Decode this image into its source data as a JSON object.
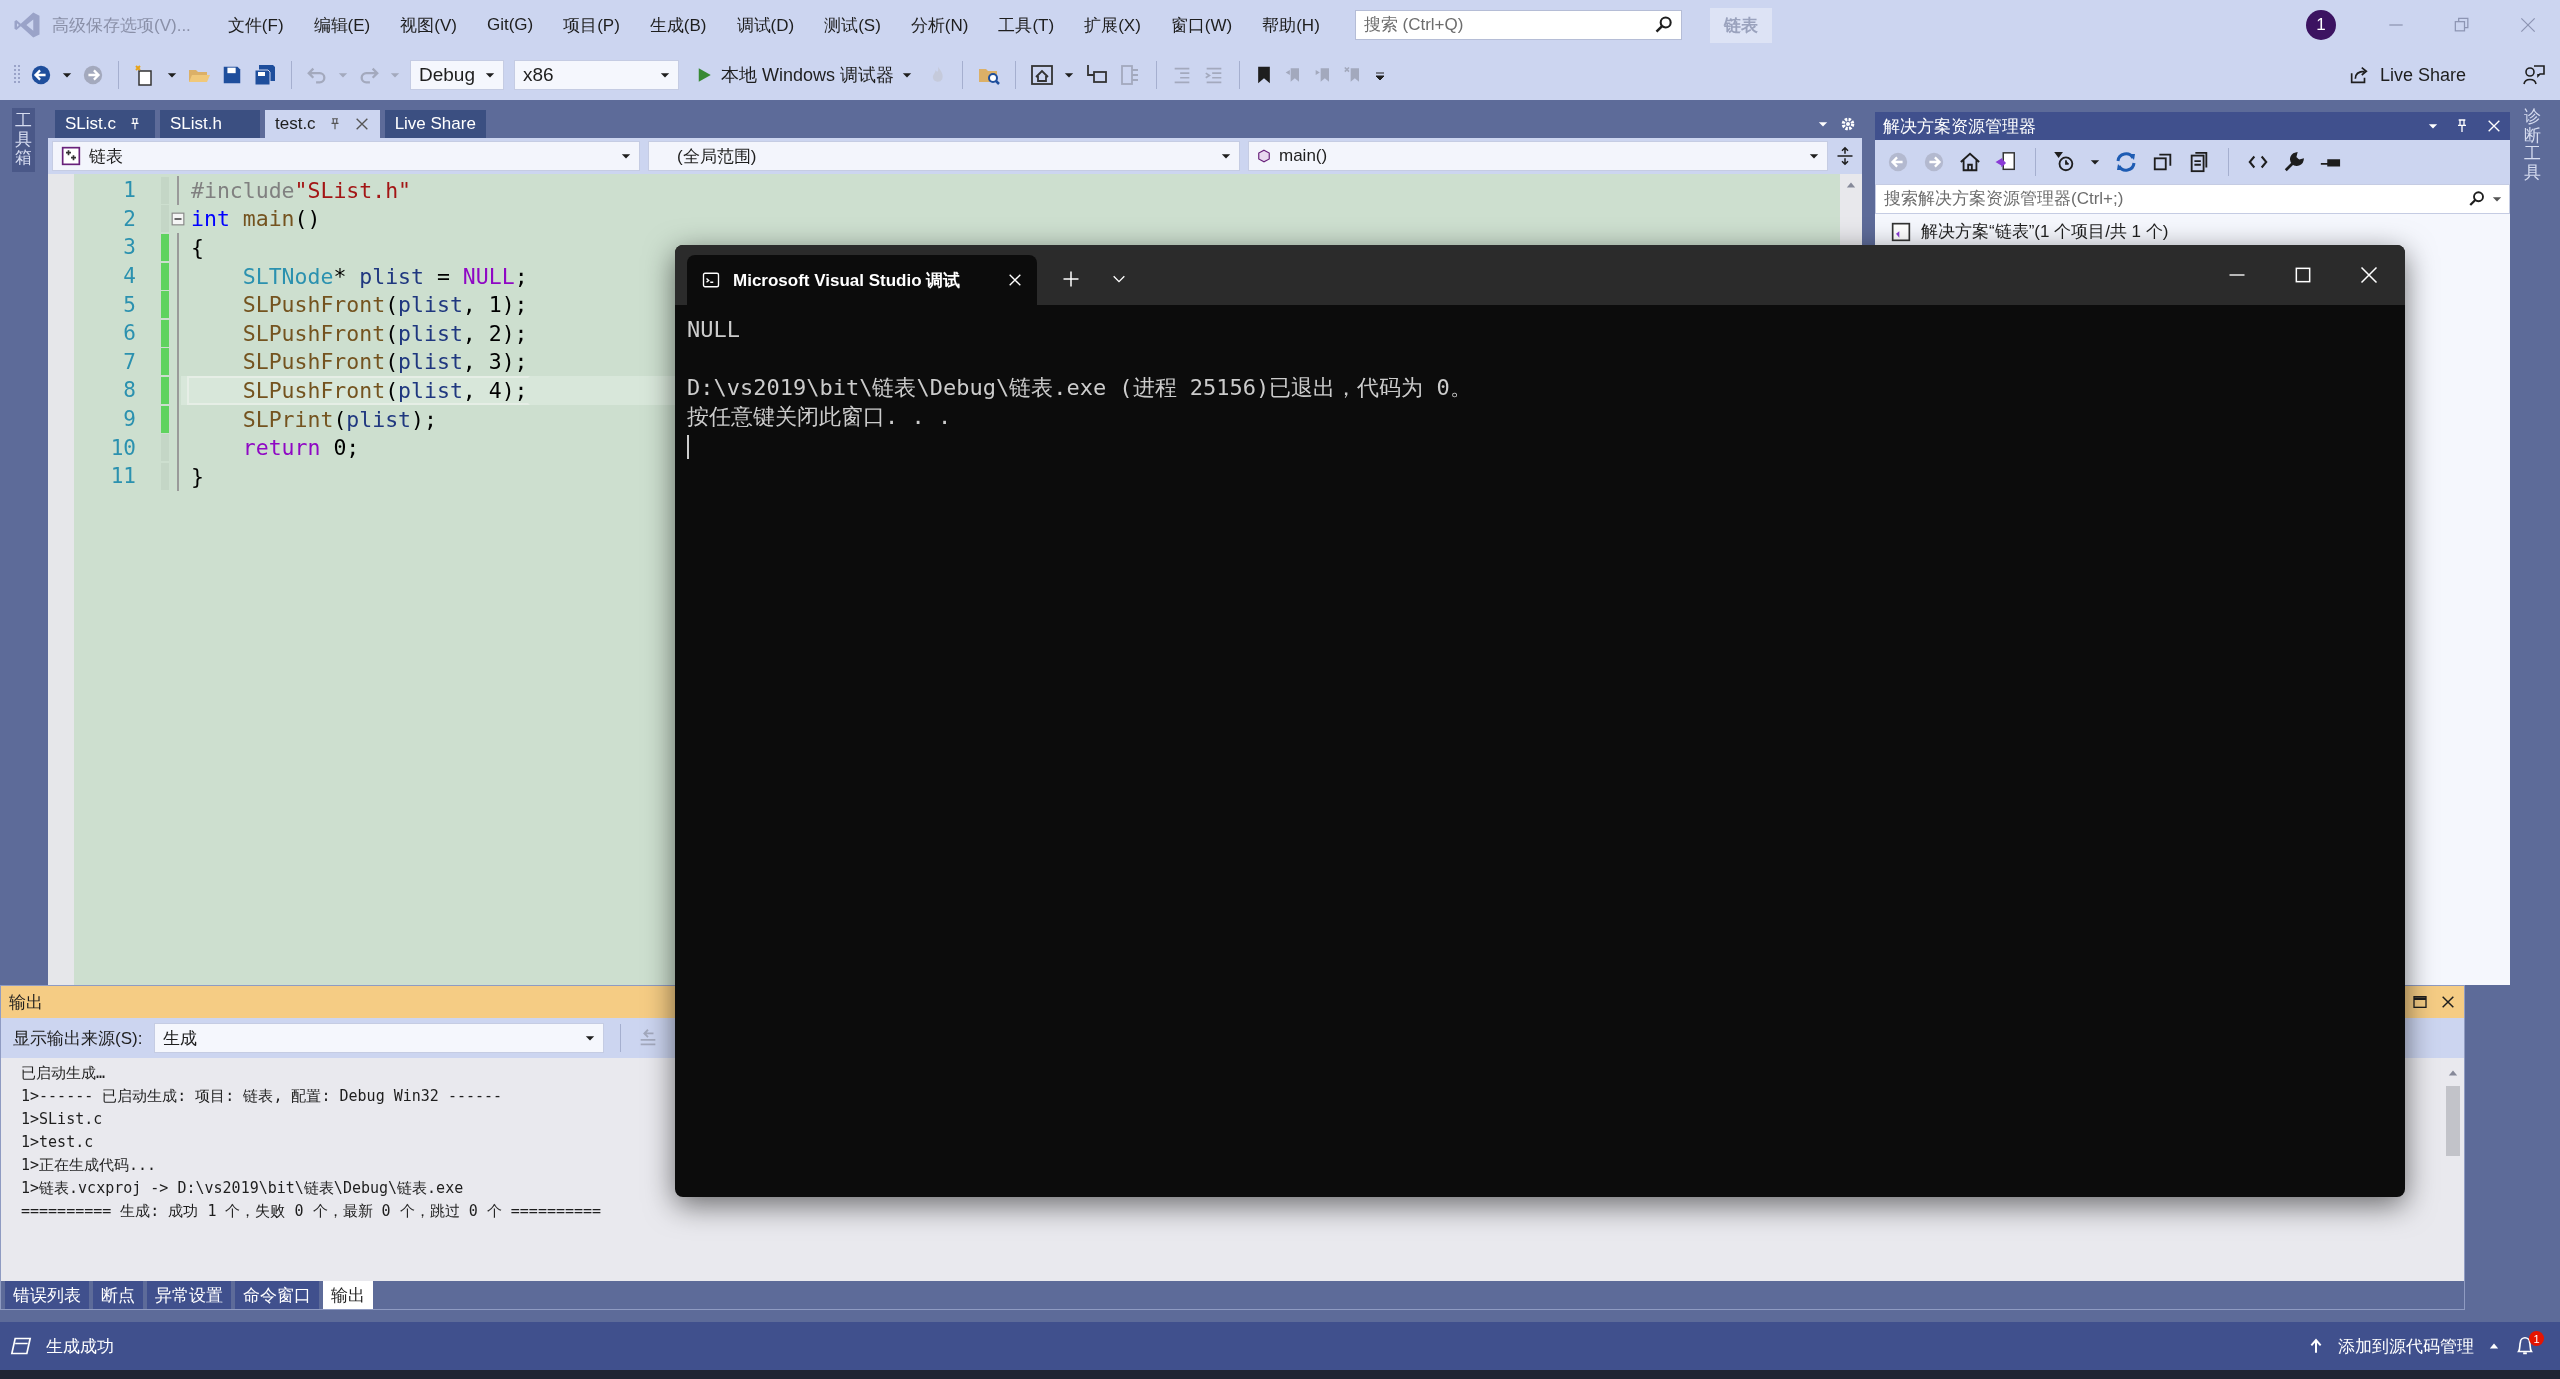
{
  "title_bar": {
    "save_options": "高级保存选项(V)...",
    "menus": [
      "文件(F)",
      "编辑(E)",
      "视图(V)",
      "Git(G)",
      "项目(P)",
      "生成(B)",
      "调试(D)",
      "测试(S)",
      "分析(N)",
      "工具(T)",
      "扩展(X)",
      "窗口(W)",
      "帮助(H)"
    ],
    "search": {
      "placeholder": "搜索 (Ctrl+Q)"
    },
    "solution_name": "链表",
    "account_badge": "1"
  },
  "toolbar": {
    "configuration": "Debug",
    "platform": "x86",
    "run_label": "本地 Windows 调试器",
    "live_share": "Live Share"
  },
  "toolbox_strip": "工具箱",
  "editor": {
    "tabs": [
      {
        "label": "SList.c",
        "selected": false,
        "pinned": true,
        "closable": false
      },
      {
        "label": "SList.h",
        "selected": false,
        "pinned": false,
        "closable": false
      },
      {
        "label": "test.c",
        "selected": true,
        "pinned": true,
        "closable": true
      },
      {
        "label": "Live Share",
        "selected": false,
        "pinned": false,
        "closable": false
      }
    ],
    "nav": {
      "project": "链表",
      "scope": "(全局范围)",
      "member": "main()"
    },
    "lines": [
      {
        "number": "1",
        "changed": false,
        "current": false,
        "foldable": false,
        "indented": false,
        "tokens": [
          {
            "kind": "preprocessor",
            "text": "#include"
          },
          {
            "kind": "string",
            "text": "\"SList.h\""
          }
        ]
      },
      {
        "number": "2",
        "changed": false,
        "current": false,
        "foldable": true,
        "indented": false,
        "tokens": [
          {
            "kind": "keyword",
            "text": "int "
          },
          {
            "kind": "function",
            "text": "main"
          },
          {
            "kind": "plain",
            "text": "()"
          }
        ]
      },
      {
        "number": "3",
        "changed": true,
        "current": false,
        "foldable": false,
        "indented": false,
        "tokens": [
          {
            "kind": "plain",
            "text": "{"
          }
        ]
      },
      {
        "number": "4",
        "changed": true,
        "current": false,
        "foldable": false,
        "indented": true,
        "tokens": [
          {
            "kind": "type",
            "text": "SLTNode"
          },
          {
            "kind": "plain",
            "text": "* "
          },
          {
            "kind": "variable",
            "text": "plist"
          },
          {
            "kind": "plain",
            "text": " = "
          },
          {
            "kind": "macro",
            "text": "NULL"
          },
          {
            "kind": "plain",
            "text": ";"
          }
        ]
      },
      {
        "number": "5",
        "changed": true,
        "current": false,
        "foldable": false,
        "indented": true,
        "tokens": [
          {
            "kind": "function",
            "text": "SLPushFront"
          },
          {
            "kind": "plain",
            "text": "("
          },
          {
            "kind": "variable",
            "text": "plist"
          },
          {
            "kind": "plain",
            "text": ", 1);"
          }
        ]
      },
      {
        "number": "6",
        "changed": true,
        "current": false,
        "foldable": false,
        "indented": true,
        "tokens": [
          {
            "kind": "function",
            "text": "SLPushFront"
          },
          {
            "kind": "plain",
            "text": "("
          },
          {
            "kind": "variable",
            "text": "plist"
          },
          {
            "kind": "plain",
            "text": ", 2);"
          }
        ]
      },
      {
        "number": "7",
        "changed": true,
        "current": false,
        "foldable": false,
        "indented": true,
        "tokens": [
          {
            "kind": "function",
            "text": "SLPushFront"
          },
          {
            "kind": "plain",
            "text": "("
          },
          {
            "kind": "variable",
            "text": "plist"
          },
          {
            "kind": "plain",
            "text": ", 3);"
          }
        ]
      },
      {
        "number": "8",
        "changed": true,
        "current": true,
        "foldable": false,
        "indented": true,
        "tokens": [
          {
            "kind": "function",
            "text": "SLPushFront"
          },
          {
            "kind": "plain",
            "text": "("
          },
          {
            "kind": "variable",
            "text": "plist"
          },
          {
            "kind": "plain",
            "text": ", 4);"
          }
        ]
      },
      {
        "number": "9",
        "changed": true,
        "current": false,
        "foldable": false,
        "indented": true,
        "tokens": [
          {
            "kind": "function",
            "text": "SLPrint"
          },
          {
            "kind": "plain",
            "text": "("
          },
          {
            "kind": "variable",
            "text": "plist"
          },
          {
            "kind": "plain",
            "text": ");"
          }
        ]
      },
      {
        "number": "10",
        "changed": false,
        "current": false,
        "foldable": false,
        "indented": true,
        "tokens": [
          {
            "kind": "control",
            "text": "return"
          },
          {
            "kind": "plain",
            "text": " 0;"
          }
        ]
      },
      {
        "number": "11",
        "changed": false,
        "current": false,
        "foldable": false,
        "indented": false,
        "tokens": [
          {
            "kind": "plain",
            "text": "}"
          }
        ]
      }
    ]
  },
  "solution_explorer": {
    "title": "解决方案资源管理器",
    "search": {
      "placeholder": "搜索解决方案资源管理器(Ctrl+;)"
    },
    "tree": [
      {
        "label": "解决方案“链表”(1 个项目/共 1 个)"
      }
    ]
  },
  "diagnostics_strip": "诊断工具",
  "output": {
    "title": "输出",
    "source_label": "显示输出来源(S):",
    "source": "生成",
    "lines": [
      "已启动生成…",
      "1>------ 已启动生成: 项目: 链表, 配置: Debug Win32 ------",
      "1>SList.c",
      "1>test.c",
      "1>正在生成代码...",
      "1>链表.vcxproj -> D:\\vs2019\\bit\\链表\\Debug\\链表.exe",
      "========== 生成: 成功 1 个，失败 0 个，最新 0 个，跳过 0 个 =========="
    ],
    "tabs": [
      {
        "label": "错误列表",
        "selected": false
      },
      {
        "label": "断点",
        "selected": false
      },
      {
        "label": "异常设置",
        "selected": false
      },
      {
        "label": "命令窗口",
        "selected": false
      },
      {
        "label": "输出",
        "selected": true
      }
    ]
  },
  "console": {
    "title": "Microsoft Visual Studio 调试",
    "blocks": [
      [
        "NULL"
      ],
      [
        "D:\\vs2019\\bit\\链表\\Debug\\链表.exe (进程 25156)已退出，代码为 0。",
        "按任意键关闭此窗口. . ."
      ]
    ]
  },
  "status_bar": {
    "message": "生成成功",
    "source_control": "添加到源代码管理",
    "notification_count": "1"
  }
}
